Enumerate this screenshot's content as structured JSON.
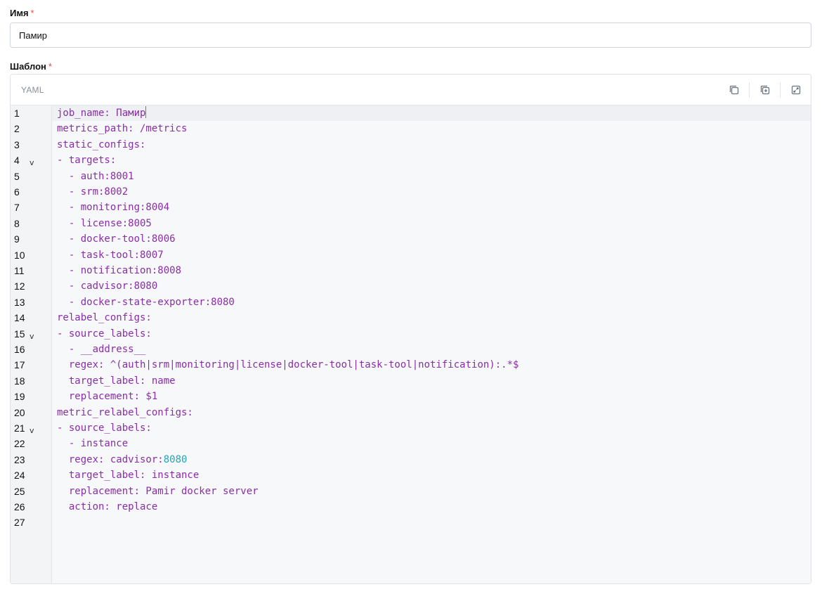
{
  "form": {
    "name_label": "Имя",
    "name_value": "Памир",
    "required_mark": "*",
    "template_label": "Шаблон"
  },
  "editor": {
    "language": "YAML",
    "toolbar": [
      "copy-icon",
      "duplicate-icon",
      "expand-icon"
    ],
    "line_numbers": [
      "1",
      "2",
      "3",
      "4",
      "5",
      "6",
      "7",
      "8",
      "9",
      "10",
      "11",
      "12",
      "13",
      "14",
      "15",
      "16",
      "17",
      "18",
      "19",
      "20",
      "21",
      "22",
      "23",
      "24",
      "25",
      "26",
      "27"
    ],
    "fold_marker": "v",
    "fold_lines": [
      4,
      15,
      21
    ],
    "lines": [
      "job_name: Памир",
      "metrics_path: /metrics",
      "static_configs:",
      "- targets:",
      "  - auth:8001",
      "  - srm:8002",
      "  - monitoring:8004",
      "  - license:8005",
      "  - docker-tool:8006",
      "  - task-tool:8007",
      "  - notification:8008",
      "  - cadvisor:8080",
      "  - docker-state-exporter:8080",
      "relabel_configs:",
      "- source_labels:",
      "  - __address__",
      "  regex: ^(auth|srm|monitoring|license|docker-tool|task-tool|notification):.*$",
      "  target_label: name",
      "  replacement: $1",
      "metric_relabel_configs:",
      "- source_labels:",
      "  - instance",
      "  regex: cadvisor:8080",
      "  target_label: instance",
      "  replacement: Pamir docker server",
      "  action: replace",
      ""
    ],
    "colors": {
      "key": "#8a2da8",
      "number": "#20a6b8",
      "cursor": "#3b82f6",
      "required": "#e5484d"
    }
  }
}
